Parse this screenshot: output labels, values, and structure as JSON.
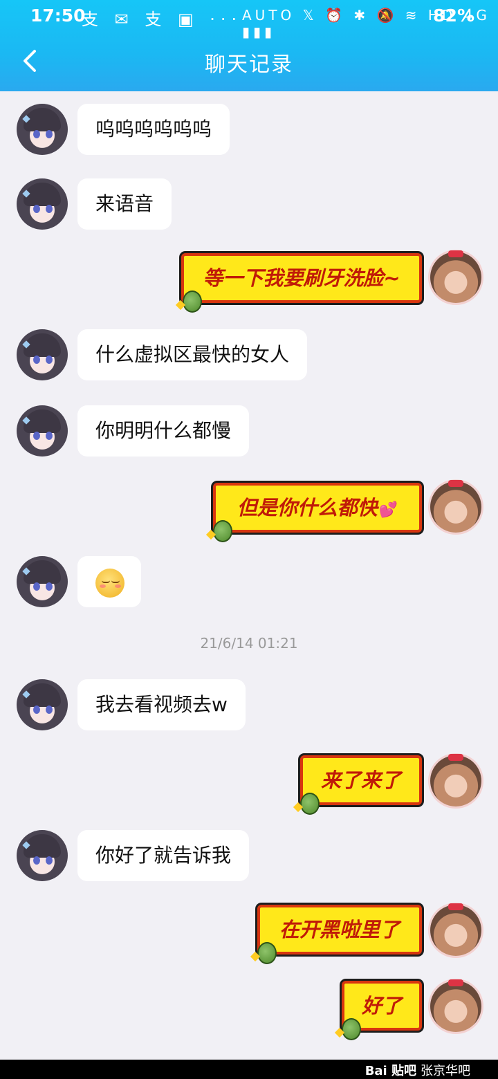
{
  "status_bar": {
    "time": "17:50",
    "left_icons": "支 ✉ 支 ▣ ···",
    "right_icons": "AUTO 𝕏 ⏰ ✱ 🔕 ≋ HD 4G ▮▮▮",
    "battery": "82%"
  },
  "header": {
    "title": "聊天记录"
  },
  "messages": [
    {
      "side": "left",
      "text": "呜呜呜呜呜呜"
    },
    {
      "side": "left",
      "text": "来语音"
    },
    {
      "side": "right",
      "text": "等一下我要刷牙洗脸~"
    },
    {
      "side": "left",
      "text": "什么虚拟区最快的女人"
    },
    {
      "side": "left",
      "text": "你明明什么都慢"
    },
    {
      "side": "right",
      "text": "但是你什么都快",
      "heart": "💕"
    },
    {
      "side": "left",
      "emoji": "😌"
    },
    {
      "side": "left",
      "text": "我去看视频去w"
    },
    {
      "side": "right",
      "text": "来了来了"
    },
    {
      "side": "left",
      "text": "你好了就告诉我"
    },
    {
      "side": "right",
      "text": "在开黑啦里了"
    },
    {
      "side": "right",
      "text": "好了"
    }
  ],
  "timestamp": "21/6/14 01:21",
  "watermark": {
    "brand": "Bai 贴吧",
    "name": "张京华吧"
  },
  "colors": {
    "header_accent": "#1bb8f3",
    "bubble_yellow": "#ffe81a",
    "bubble_border": "#d8360f"
  }
}
